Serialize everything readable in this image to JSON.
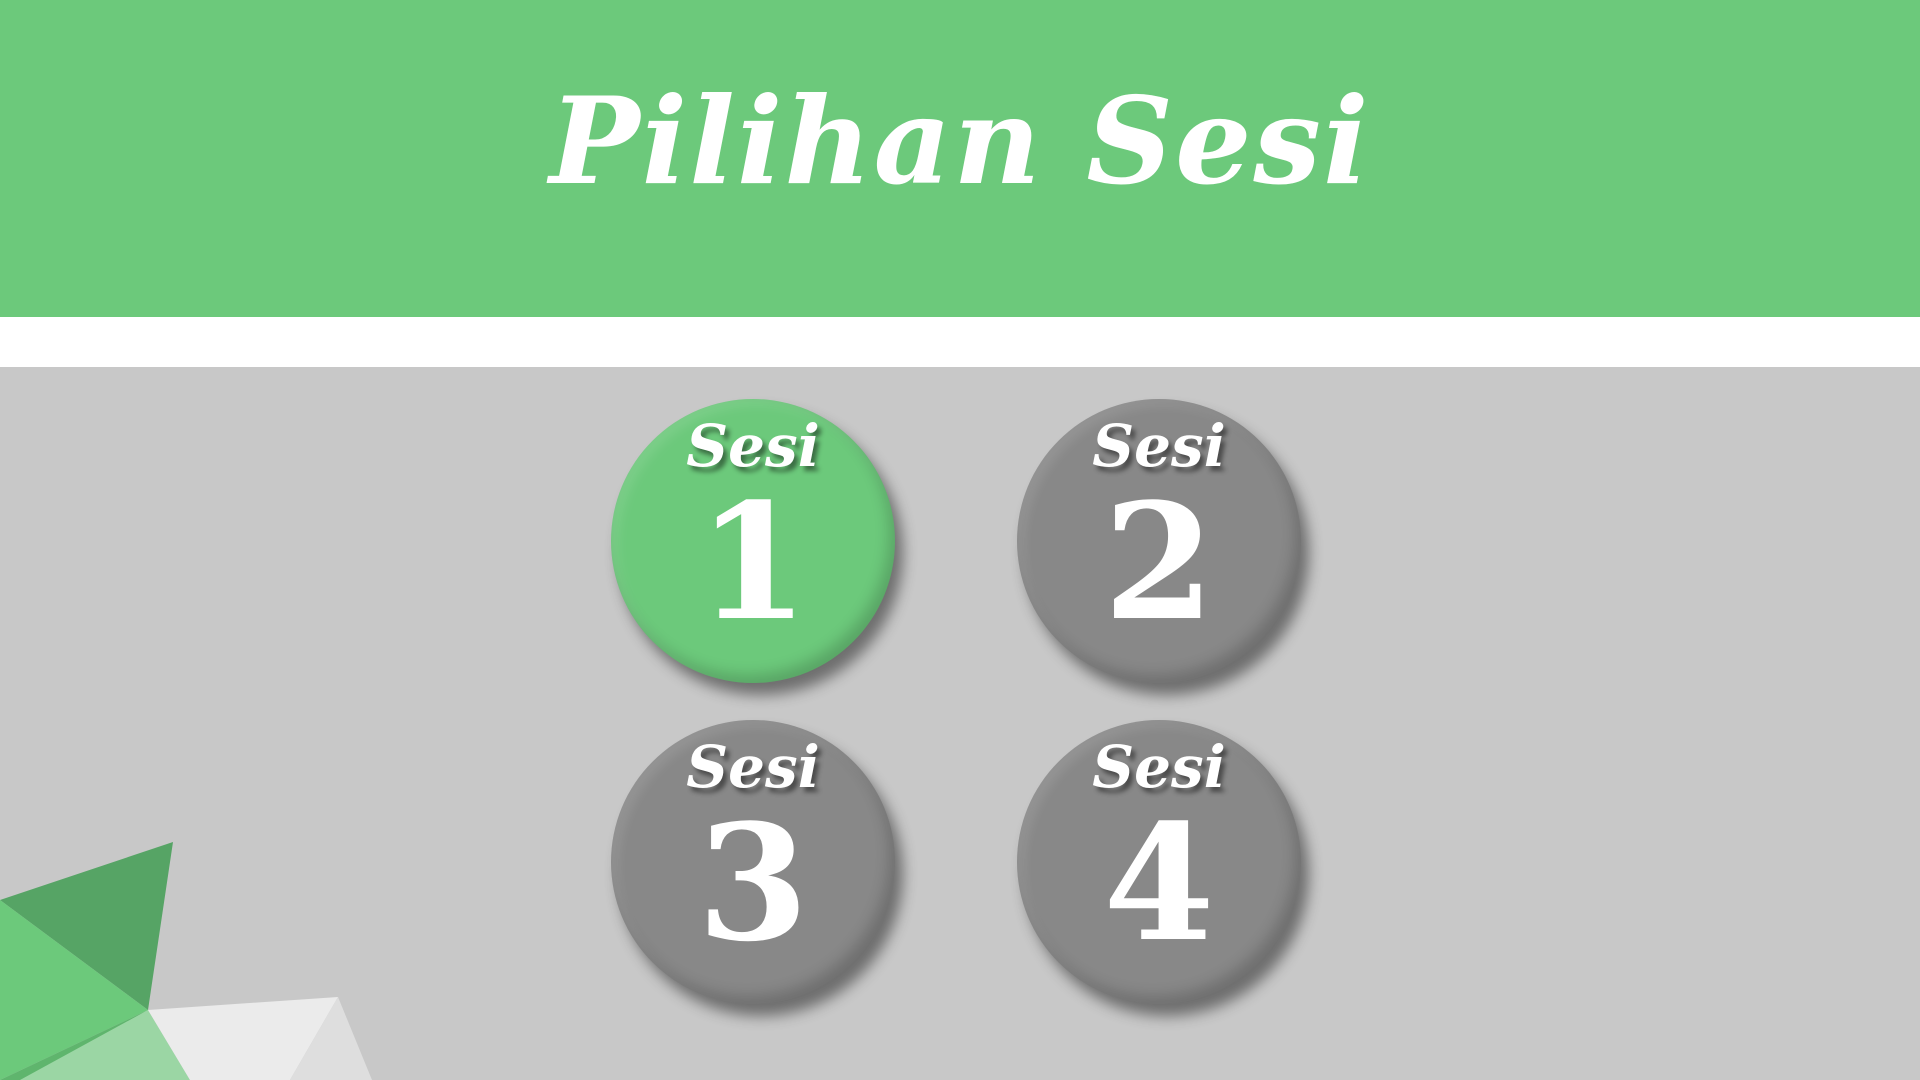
{
  "title": "Pilihan Sesi",
  "sessions": [
    {
      "label": "Sesi",
      "number": "1",
      "state": "active"
    },
    {
      "label": "Sesi",
      "number": "2",
      "state": "inactive"
    },
    {
      "label": "Sesi",
      "number": "3",
      "state": "inactive"
    },
    {
      "label": "Sesi",
      "number": "4",
      "state": "inactive"
    }
  ],
  "colors": {
    "accent_green": "#6cc97b",
    "inactive_grey": "#888888",
    "background": "#c8c8c8",
    "text": "#ffffff"
  }
}
